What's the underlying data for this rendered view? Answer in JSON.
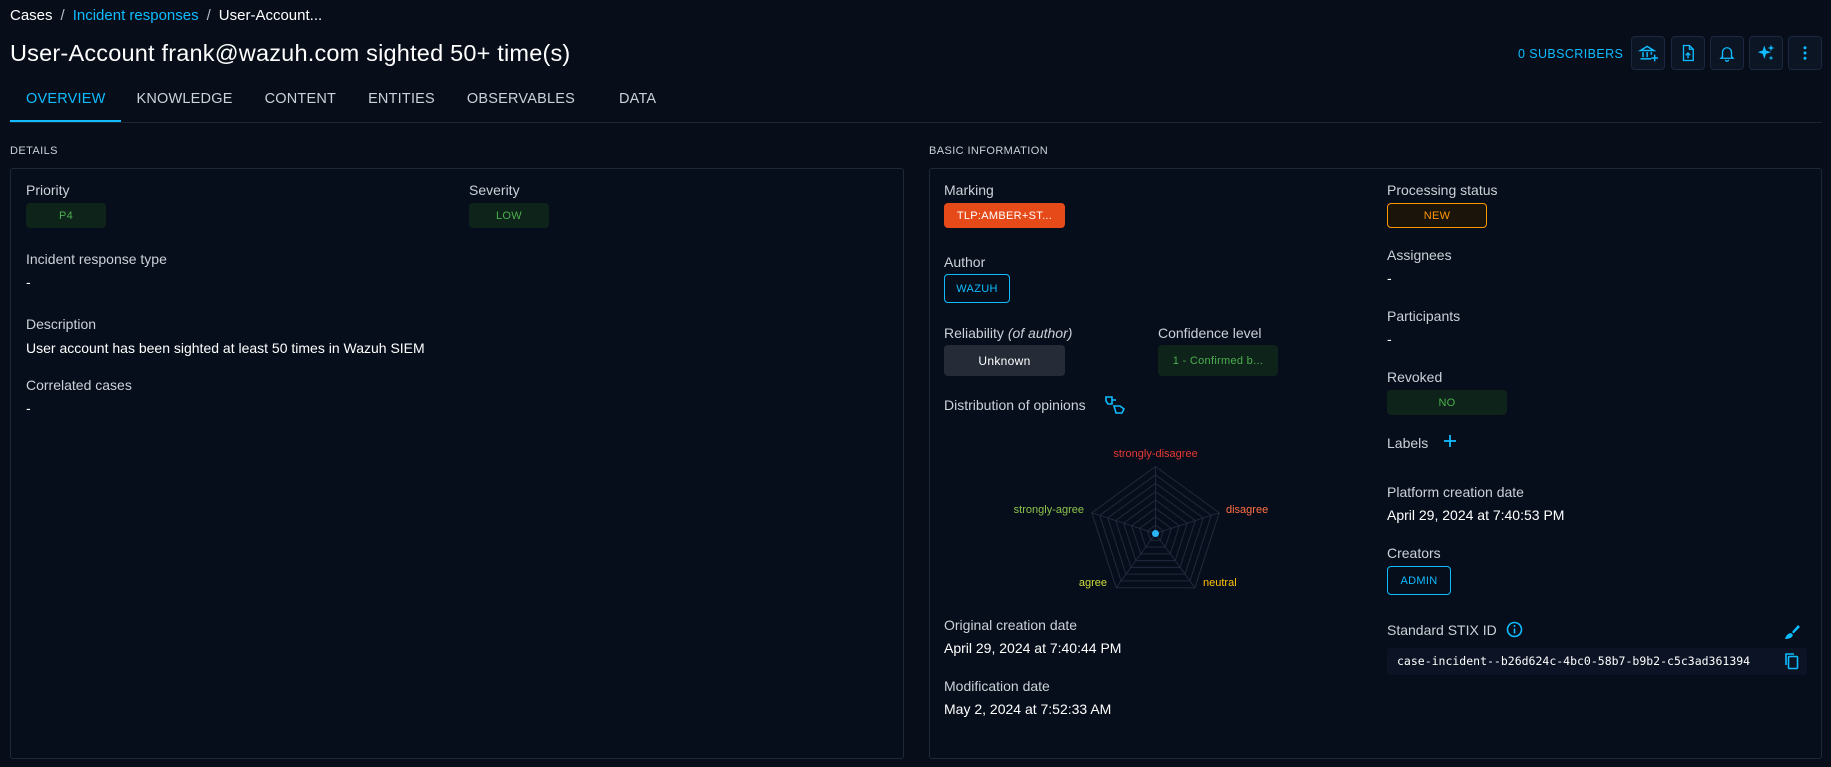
{
  "breadcrumb": {
    "root": "Cases",
    "parent": "Incident responses",
    "current": "User-Account..."
  },
  "header": {
    "title": "User-Account frank@wazuh.com sighted 50+ time(s)",
    "subscribers": "0 SUBSCRIBERS",
    "actions": [
      "bank-plus-icon",
      "file-export-icon",
      "bell-icon",
      "ai-sparkle-icon",
      "more-vert-icon"
    ]
  },
  "tabs": [
    {
      "label": "OVERVIEW",
      "active": true
    },
    {
      "label": "KNOWLEDGE"
    },
    {
      "label": "CONTENT"
    },
    {
      "label": "ENTITIES"
    },
    {
      "label": "OBSERVABLES"
    },
    {
      "label": "DATA"
    }
  ],
  "details": {
    "section_title": "DETAILS",
    "priority_label": "Priority",
    "priority_value": "P4",
    "severity_label": "Severity",
    "severity_value": "LOW",
    "type_label": "Incident response type",
    "type_value": "-",
    "description_label": "Description",
    "description_value": "User account has been sighted at least 50 times in Wazuh SIEM",
    "correlated_label": "Correlated cases",
    "correlated_value": "-"
  },
  "basic": {
    "section_title": "BASIC INFORMATION",
    "marking_label": "Marking",
    "marking_value": "TLP:AMBER+ST...",
    "author_label": "Author",
    "author_value": "WAZUH",
    "reliability_label": "Reliability",
    "reliability_suffix": "(of author)",
    "reliability_value": "Unknown",
    "confidence_label": "Confidence level",
    "confidence_value": "1 - Confirmed b...",
    "opinions_label": "Distribution of opinions",
    "radar": {
      "axes": [
        "strongly-disagree",
        "disagree",
        "neutral",
        "agree",
        "strongly-agree"
      ],
      "colors": {
        "strongly-disagree": "#e53935",
        "disagree": "#ff7043",
        "neutral": "#ffc107",
        "agree": "#cddc39",
        "strongly-agree": "#8bc34a"
      }
    },
    "original_creation_label": "Original creation date",
    "original_creation_value": "April 29, 2024 at 7:40:44 PM",
    "modification_label": "Modification date",
    "modification_value": "May 2, 2024 at 7:52:33 AM",
    "processing_label": "Processing status",
    "processing_value": "NEW",
    "assignees_label": "Assignees",
    "assignees_value": "-",
    "participants_label": "Participants",
    "participants_value": "-",
    "revoked_label": "Revoked",
    "revoked_value": "NO",
    "labels_label": "Labels",
    "platform_creation_label": "Platform creation date",
    "platform_creation_value": "April 29, 2024 at 7:40:53 PM",
    "creators_label": "Creators",
    "creators_value": "ADMIN",
    "stix_label": "Standard STIX ID",
    "stix_value": "case-incident--b26d624c-4bc0-58b7-b9b2-c5c3ad361394"
  },
  "colors": {
    "accent": "#0fbcff",
    "background": "#070d19",
    "marking": "#e64a19",
    "status_new": "#ff9800",
    "green": "#4caf50"
  }
}
